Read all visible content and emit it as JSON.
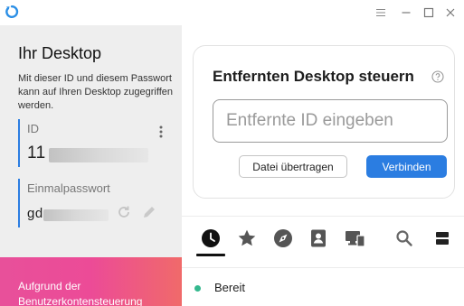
{
  "titlebar": {
    "icons": [
      "app-logo-icon",
      "menu-icon",
      "minimize-icon",
      "maximize-icon",
      "close-icon"
    ]
  },
  "left_panel": {
    "title": "Ihr Desktop",
    "description": "Mit dieser ID und diesem Passwort kann auf Ihren Desktop zugegriffen werden.",
    "id_field": {
      "label": "ID",
      "value": "11"
    },
    "password_field": {
      "label": "Einmalpasswort",
      "value": "gd"
    },
    "banner_text": "Aufgrund der Benutzerkontensteuerung"
  },
  "card": {
    "title": "Entfernten Desktop steuern",
    "input_placeholder": "Entfernte ID eingeben",
    "transfer_label": "Datei übertragen",
    "connect_label": "Verbinden"
  },
  "tabs": [
    "clock-icon",
    "star-icon",
    "compass-icon",
    "address-book-icon",
    "lan-devices-icon",
    "search-icon",
    "view-toggle-icon"
  ],
  "status": {
    "text": "Bereit",
    "color": "#34b88e"
  },
  "colors": {
    "accent": "#2b7de1",
    "banner_start": "#e8509a",
    "banner_end": "#f06a6a"
  }
}
